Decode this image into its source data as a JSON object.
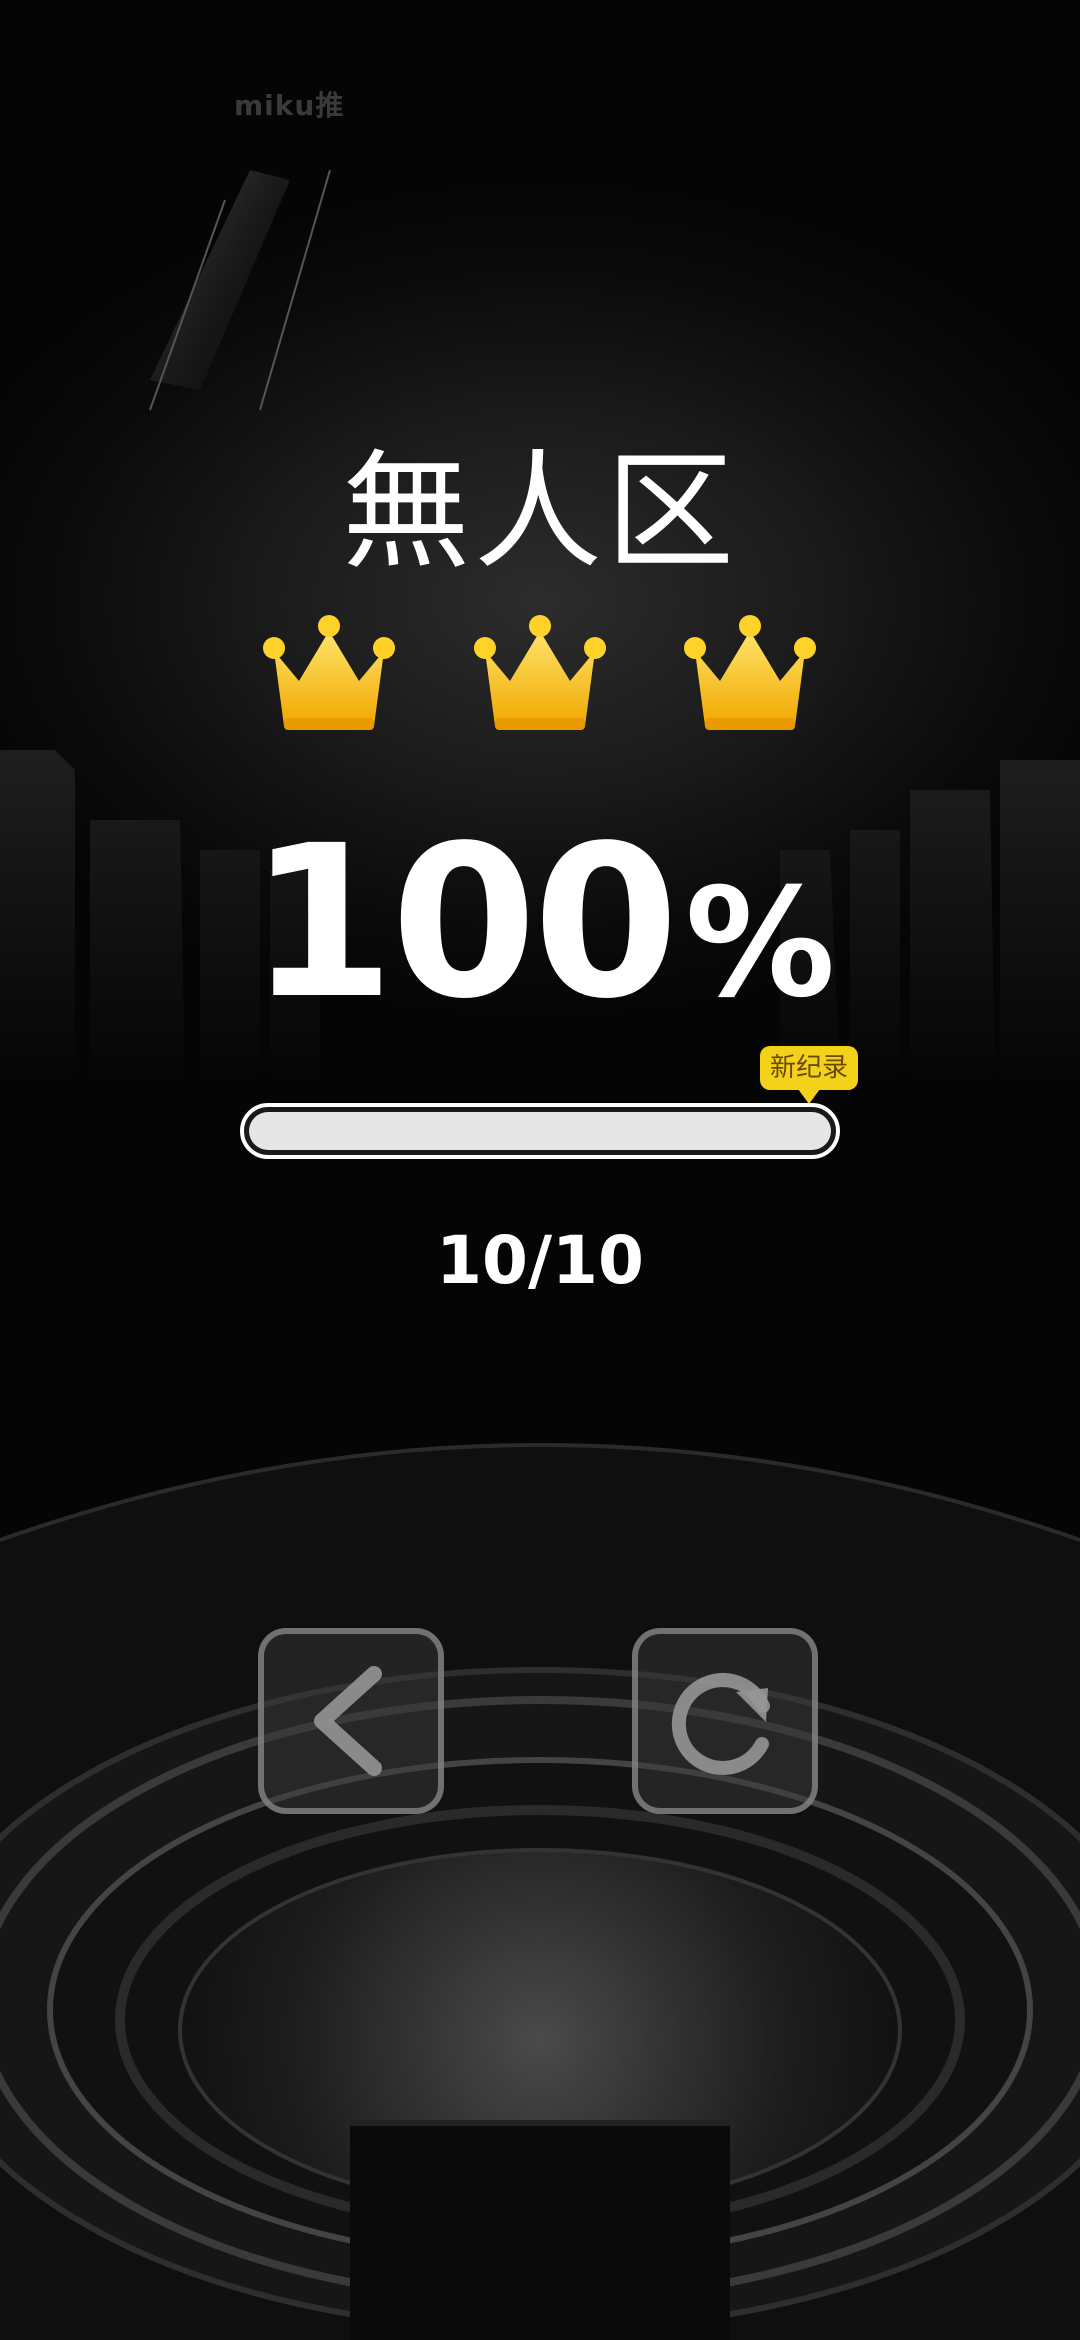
{
  "watermark": "miku推",
  "level": {
    "title": "無人区",
    "stars_earned": 3,
    "stars_total": 3,
    "percent_value": "100",
    "percent_sign": "%",
    "record_badge": "新纪录",
    "progress": 1.0,
    "count": "10/10"
  },
  "icons": {
    "crown": "crown-icon",
    "back": "chevron-left-icon",
    "retry": "refresh-icon"
  },
  "colors": {
    "crown": "#ffc800",
    "badge": "#f5d21a",
    "text": "#ffffff"
  }
}
